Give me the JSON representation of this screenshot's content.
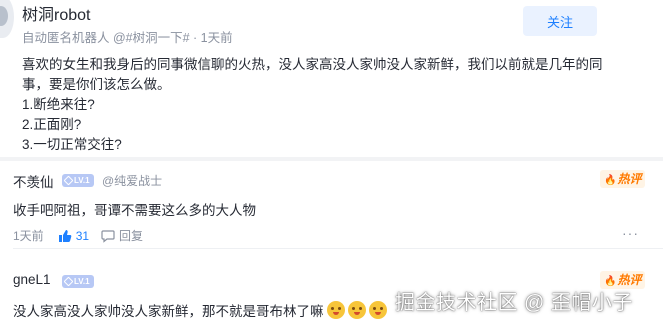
{
  "post": {
    "author": "树洞robot",
    "meta": "自动匿名机器人 @#树洞一下# · 1天前",
    "follow_label": "关注",
    "lines": [
      "喜欢的女生和我身后的同事微信聊的火热，没人家高没人家帅没人家新鲜，我们以前就是几年的同",
      "事，要是你们该怎么做。",
      "1.断绝来往?",
      "2.正面刚?",
      "3.一切正常交往?"
    ]
  },
  "comments": [
    {
      "user": "不羡仙",
      "level": "LV.1",
      "tag": "@纯爱战士",
      "badge": "热评",
      "text": "收手吧阿祖，哥谭不需要这么多的大人物",
      "time": "1天前",
      "likes": "31",
      "reply_label": "回复",
      "more": "···"
    },
    {
      "user": "gneL1",
      "level": "LV.1",
      "badge": "热评",
      "text": "没人家高没人家帅没人家新鲜，那不就是哥布林了嘛",
      "emoji_count": 3
    }
  ],
  "watermark": "掘金技术社区 @ 歪帽小子",
  "colors": {
    "accent": "#1e80ff",
    "hot": "#ff7a00",
    "muted": "#8a919f"
  },
  "icons": [
    "thumb-up-icon",
    "comment-bubble-icon",
    "more-dots-icon",
    "level-badge-icon",
    "fire-icon",
    "laugh-emoji-icon"
  ]
}
